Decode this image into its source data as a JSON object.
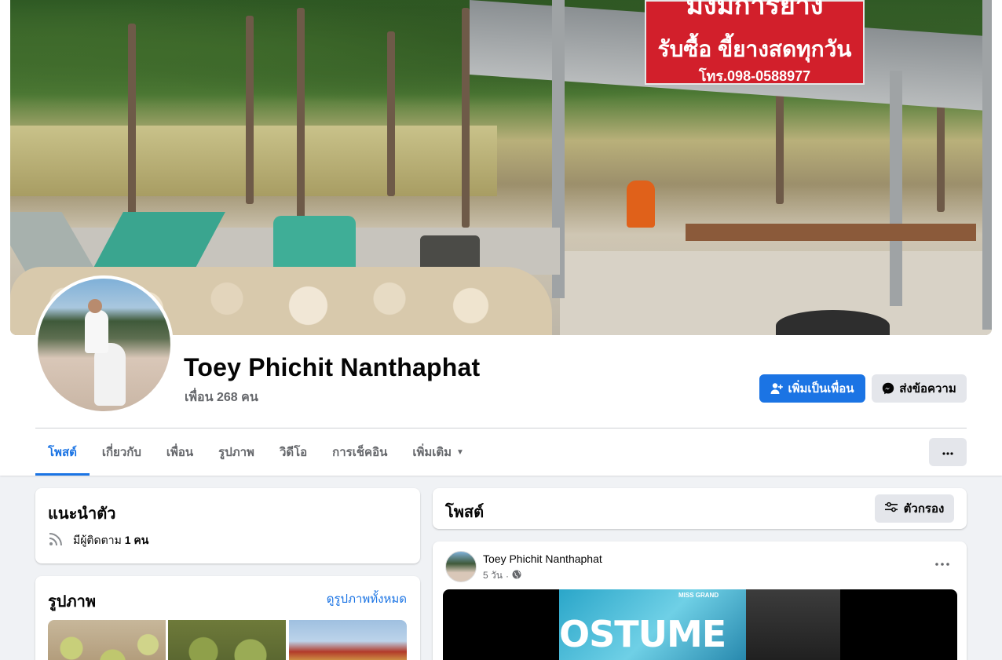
{
  "cover": {
    "sign_line1": "มงมการยาง",
    "sign_line2": "รับซื้อ ขี้ยางสดทุกวัน",
    "sign_line3": "โทร.098-0588977"
  },
  "profile": {
    "name": "Toey Phichit Nanthaphat",
    "friends": "เพื่อน 268 คน"
  },
  "actions": {
    "add_friend": "เพิ่มเป็นเพื่อน",
    "message": "ส่งข้อความ"
  },
  "tabs": [
    {
      "label": "โพสต์",
      "active": true
    },
    {
      "label": "เกี่ยวกับ",
      "active": false
    },
    {
      "label": "เพื่อน",
      "active": false
    },
    {
      "label": "รูปภาพ",
      "active": false
    },
    {
      "label": "วิดีโอ",
      "active": false
    },
    {
      "label": "การเช็คอิน",
      "active": false
    },
    {
      "label": "เพิ่มเติม",
      "active": false
    }
  ],
  "intro": {
    "title": "แนะนำตัว",
    "followers_prefix": "มีผู้ติดตาม",
    "followers_count": "1 คน"
  },
  "photos": {
    "title": "รูปภาพ",
    "see_all": "ดูรูปภาพทั้งหมด"
  },
  "posts": {
    "title": "โพสต์",
    "filter": "ตัวกรอง"
  },
  "post": {
    "author": "Toey Phichit Nanthaphat",
    "time": "5 วัน",
    "separator": "·",
    "media_text": "OSTUME",
    "media_brand": "MISS GRAND"
  },
  "colors": {
    "accent": "#1b74e4",
    "background": "#f0f2f5",
    "secondary_text": "#65676b",
    "button_gray": "#e4e6eb"
  }
}
